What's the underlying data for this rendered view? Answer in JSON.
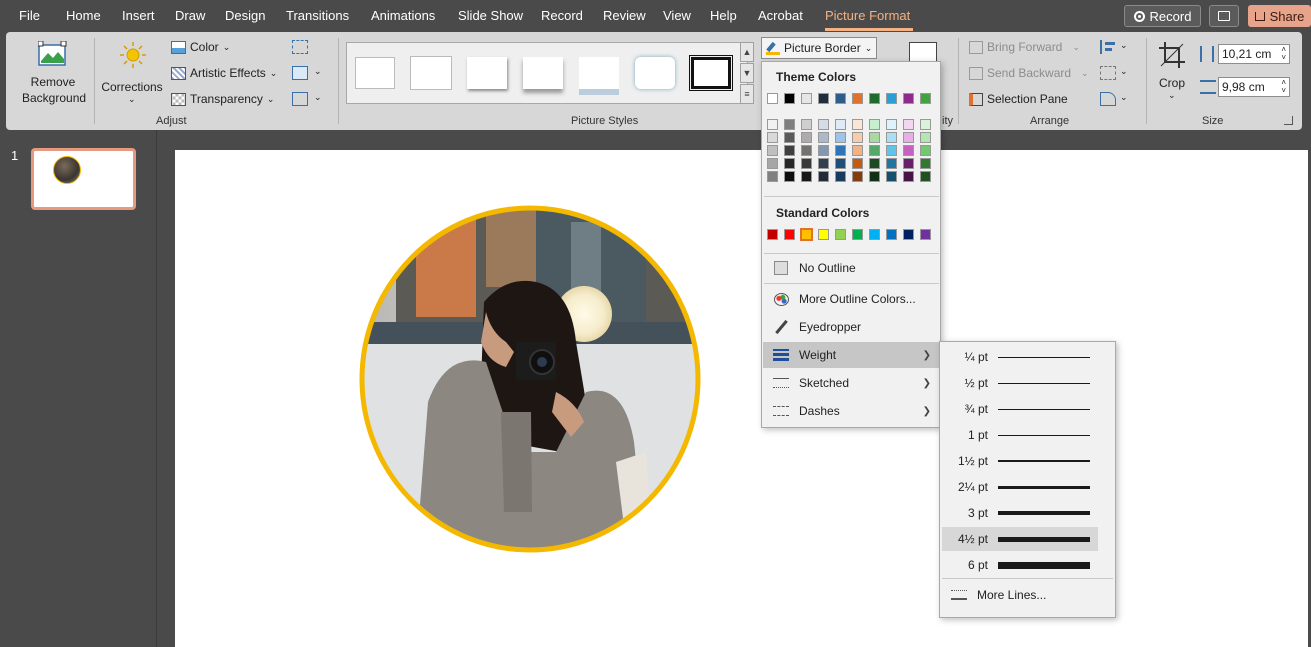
{
  "tabs": [
    "File",
    "Home",
    "Insert",
    "Draw",
    "Design",
    "Transitions",
    "Animations",
    "Slide Show",
    "Record",
    "Review",
    "View",
    "Help",
    "Acrobat",
    "Picture Format"
  ],
  "active_tab": "Picture Format",
  "top_buttons": {
    "record": "Record",
    "share": "Share"
  },
  "ribbon": {
    "remove_background": "Remove Background",
    "corrections": "Corrections",
    "color": "Color",
    "artistic_effects": "Artistic Effects",
    "transparency": "Transparency",
    "picture_border": "Picture Border",
    "bring_forward": "Bring Forward",
    "send_backward": "Send Backward",
    "selection_pane": "Selection Pane",
    "crop": "Crop",
    "height": "10,21 cm",
    "width": "9,98 cm",
    "groups": {
      "adjust": "Adjust",
      "picture_styles": "Picture Styles",
      "accessibility_partial": "ity",
      "arrange": "Arrange",
      "size": "Size"
    }
  },
  "slide_number": "1",
  "menu": {
    "theme_colors": "Theme Colors",
    "standard_colors": "Standard Colors",
    "theme_row": [
      "#ffffff",
      "#000000",
      "#e7e6e6",
      "#1f2d3d",
      "#2e5d8a",
      "#e0722e",
      "#1f6b2e",
      "#2a9fd6",
      "#8e2a8c",
      "#3fa33f"
    ],
    "theme_shades": [
      [
        "#f2f2f2",
        "#d9d9d9",
        "#bfbfbf",
        "#a6a6a6",
        "#808080"
      ],
      [
        "#7f7f7f",
        "#595959",
        "#3f3f3f",
        "#262626",
        "#0d0d0d"
      ],
      [
        "#d0cece",
        "#aeabab",
        "#757171",
        "#3a3838",
        "#171616"
      ],
      [
        "#d6dce5",
        "#adb9ca",
        "#8497b0",
        "#323f4f",
        "#222a35"
      ],
      [
        "#deebf7",
        "#9dc3e6",
        "#2e75b6",
        "#1f4e79",
        "#1a3a5c"
      ],
      [
        "#fbe5d6",
        "#f8cbad",
        "#f4b183",
        "#c55a11",
        "#843c0c"
      ],
      [
        "#c6efce",
        "#a9d8a0",
        "#55a868",
        "#1c4a22",
        "#123016"
      ],
      [
        "#ddf2fb",
        "#a9dff4",
        "#60c4ea",
        "#1f77a1",
        "#144f6b"
      ],
      [
        "#f4d6f3",
        "#e8aee6",
        "#c461c1",
        "#6a1f68",
        "#471445"
      ],
      [
        "#d9f2d9",
        "#b3e6b3",
        "#70c970",
        "#2f7a2f",
        "#1f521f"
      ]
    ],
    "standard_row": [
      "#c00000",
      "#ff0000",
      "#ffc000",
      "#ffff00",
      "#92d050",
      "#00b050",
      "#00b0f0",
      "#0070c0",
      "#002060",
      "#7030a0"
    ],
    "no_outline": "No Outline",
    "more_outline_colors": "More Outline Colors...",
    "eyedropper": "Eyedropper",
    "weight": "Weight",
    "sketched": "Sketched",
    "dashes": "Dashes"
  },
  "weights": [
    {
      "label": "¼ pt",
      "thickness_pt": 0.25
    },
    {
      "label": "½ pt",
      "thickness_pt": 0.5
    },
    {
      "label": "¾ pt",
      "thickness_pt": 0.75
    },
    {
      "label": "1 pt",
      "thickness_pt": 1
    },
    {
      "label": "1½ pt",
      "thickness_pt": 1.5
    },
    {
      "label": "2¼ pt",
      "thickness_pt": 2.25
    },
    {
      "label": "3 pt",
      "thickness_pt": 3
    },
    {
      "label": "4½ pt",
      "thickness_pt": 4.5
    },
    {
      "label": "6 pt",
      "thickness_pt": 6
    }
  ],
  "highlighted_weight": "4½ pt",
  "more_lines": "More Lines...",
  "colors": {
    "accent": "#f4b183",
    "picture_border": "#f5b800",
    "ribbon_bg": "#d7d7d7",
    "app_bg": "#4a4a4a"
  }
}
